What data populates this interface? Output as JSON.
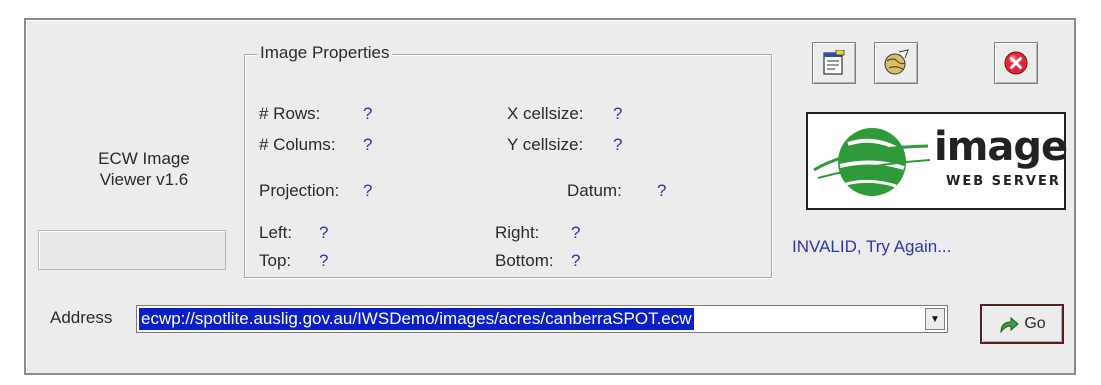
{
  "app": {
    "title": "ECW Image\nViewer v1.6"
  },
  "properties": {
    "legend": "Image Properties",
    "rows_label": "# Rows:",
    "rows_value": "?",
    "cols_label": "# Colums:",
    "cols_value": "?",
    "xcell_label": "X cellsize:",
    "xcell_value": "?",
    "ycell_label": "Y cellsize:",
    "ycell_value": "?",
    "projection_label": "Projection:",
    "projection_value": "?",
    "datum_label": "Datum:",
    "datum_value": "?",
    "left_label": "Left:",
    "left_value": "?",
    "right_label": "Right:",
    "right_value": "?",
    "top_label": "Top:",
    "top_value": "?",
    "bottom_label": "Bottom:",
    "bottom_value": "?"
  },
  "toolbar": {
    "icons": [
      "properties-icon",
      "globe-icon",
      "close-icon"
    ]
  },
  "logo": {
    "word": "image",
    "sub": "WEB SERVER",
    "brand_color": "#2f9a3a"
  },
  "status": {
    "text": "INVALID, Try Again..."
  },
  "address": {
    "label": "Address",
    "value": "ecwp://spotlite.auslig.gov.au/IWSDemo/images/acres/canberraSPOT.ecw"
  },
  "go": {
    "label": "Go"
  }
}
